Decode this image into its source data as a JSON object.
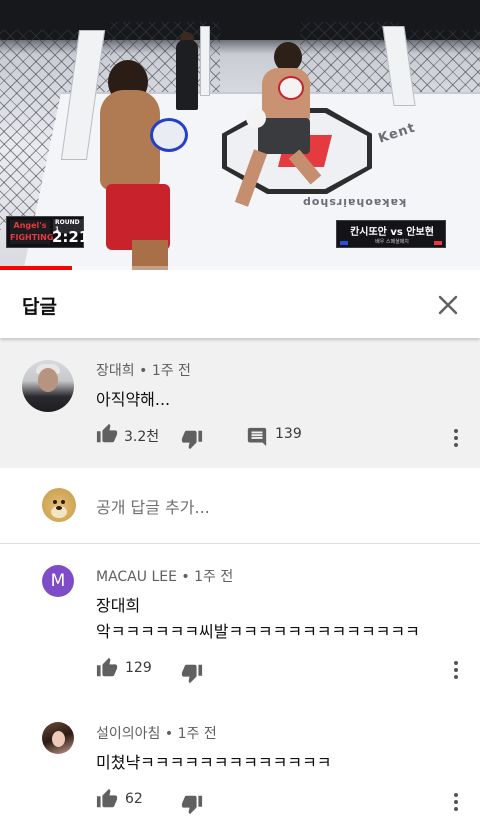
{
  "video": {
    "scoreboard_brand": "Angel's FIGHTING",
    "round_label": "ROUND 1",
    "time": "2:21",
    "fighters": "칸시또안 vs 안보현",
    "fighters_sub": "배우 스페셜매치",
    "mat_texts": [
      "Kent",
      "kakaohairshop"
    ],
    "progress": 0.15,
    "accent_color": "#ff0000"
  },
  "header": {
    "title": "답글",
    "close_icon": "close-icon"
  },
  "parent_comment": {
    "author": "장대희",
    "time": "1주 전",
    "text": "아직약해...",
    "likes": "3.2천",
    "replies": "139"
  },
  "add_reply": {
    "placeholder": "공개 답글 추가..."
  },
  "replies": [
    {
      "author": "MACAU LEE",
      "avatar_letter": "M",
      "avatar_color": "#7d4cc6",
      "time": "1주 전",
      "text_line1": "장대희",
      "text_line2": "악ㅋㅋㅋㅋㅋㅋ씨발ㅋㅋㅋㅋㅋㅋㅋㅋㅋㅋㅋㅋㅋ",
      "likes": "129"
    },
    {
      "author": "설이의아침",
      "time": "1주 전",
      "text_line1": "미쳤냑ㅋㅋㅋㅋㅋㅋㅋㅋㅋㅋㅋㅋㅋ",
      "likes": "62"
    }
  ],
  "separator": "•"
}
